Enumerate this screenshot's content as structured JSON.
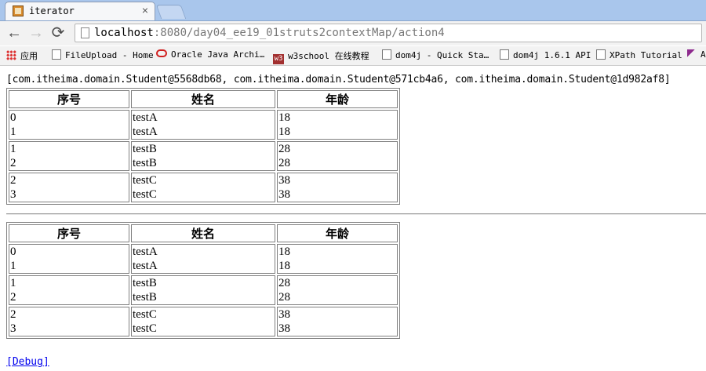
{
  "browser": {
    "tab_title": "iterator",
    "tab_close": "×",
    "url_host": "localhost",
    "url_rest": ":8080/day04_ee19_01struts2contextMap/action4",
    "nav": {
      "back": "←",
      "forward": "→",
      "reload": "⟳"
    }
  },
  "bookmarks": [
    {
      "label": "应用",
      "icon": "apps-icon"
    },
    {
      "label": "FileUpload - Home",
      "icon": "page-icon"
    },
    {
      "label": "Oracle Java Archi…",
      "icon": "oracle-icon"
    },
    {
      "label": "w3school 在线教程",
      "icon": "w3school-icon"
    },
    {
      "label": "dom4j - Quick Sta…",
      "icon": "page-icon"
    },
    {
      "label": "dom4j 1.6.1 API",
      "icon": "page-icon"
    },
    {
      "label": "XPath Tutorial",
      "icon": "page-icon"
    },
    {
      "label": "A",
      "icon": "feather-icon"
    }
  ],
  "page": {
    "list_text": "[com.itheima.domain.Student@5568db68, com.itheima.domain.Student@571cb4a6, com.itheima.domain.Student@1d982af8]",
    "headers": [
      "序号",
      "姓名",
      "年龄"
    ],
    "rows": [
      {
        "index": [
          "0",
          "1"
        ],
        "name": [
          "testA",
          "testA"
        ],
        "age": [
          "18",
          "18"
        ]
      },
      {
        "index": [
          "1",
          "2"
        ],
        "name": [
          "testB",
          "testB"
        ],
        "age": [
          "28",
          "28"
        ]
      },
      {
        "index": [
          "2",
          "3"
        ],
        "name": [
          "testC",
          "testC"
        ],
        "age": [
          "38",
          "38"
        ]
      }
    ],
    "debug_link": "[Debug]"
  }
}
